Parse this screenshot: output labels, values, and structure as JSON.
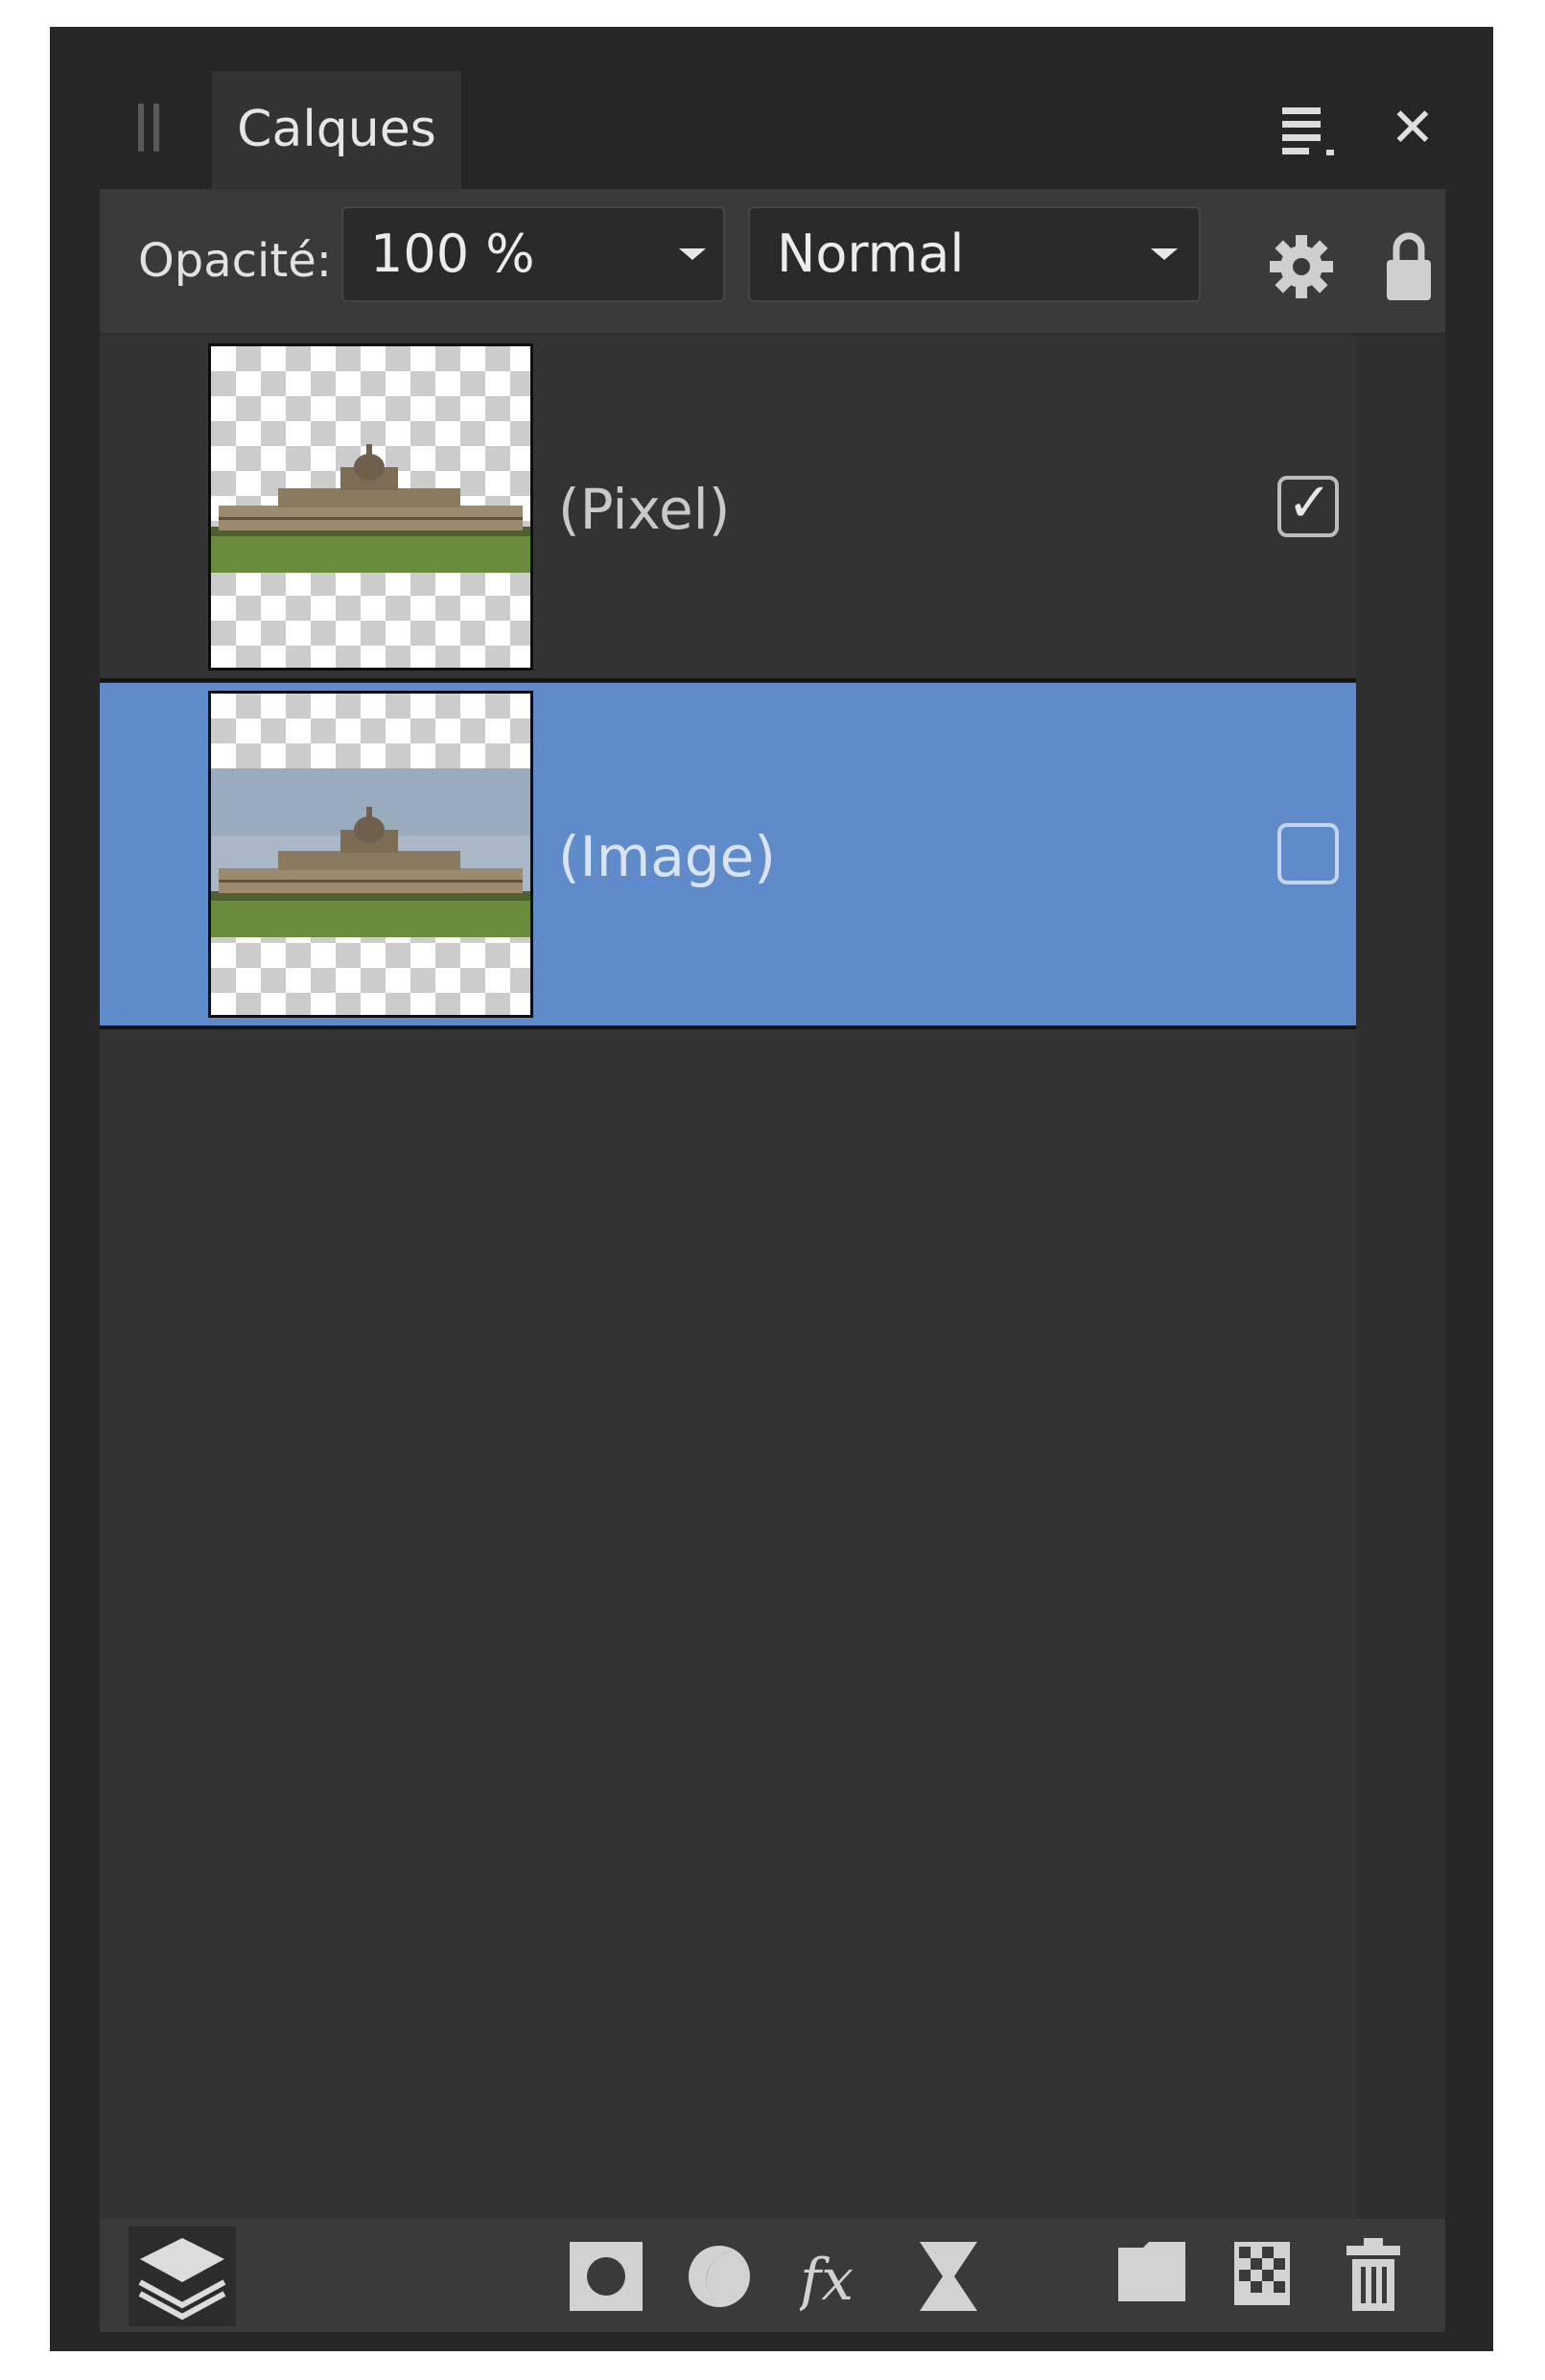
{
  "panel": {
    "tab_label": "Calques",
    "menu_icon": "panel-menu-icon",
    "close_icon": "close-icon"
  },
  "toolbar": {
    "opacity_label": "Opacité:",
    "opacity_value": "100 %",
    "blend_mode": "Normal"
  },
  "layers": [
    {
      "name": "(Pixel)",
      "checked": true,
      "selected": false
    },
    {
      "name": "(Image)",
      "checked": false,
      "selected": true
    }
  ],
  "footer_icons": [
    "layers-stack-icon",
    "mask-icon",
    "adjustment-icon",
    "fx-icon",
    "live-filter-icon",
    "group-icon",
    "new-pixel-layer-icon",
    "delete-icon"
  ],
  "colors": {
    "selection": "#608bcb",
    "panel_bg": "#333333",
    "toolbar_bg": "#3a3a3a"
  }
}
